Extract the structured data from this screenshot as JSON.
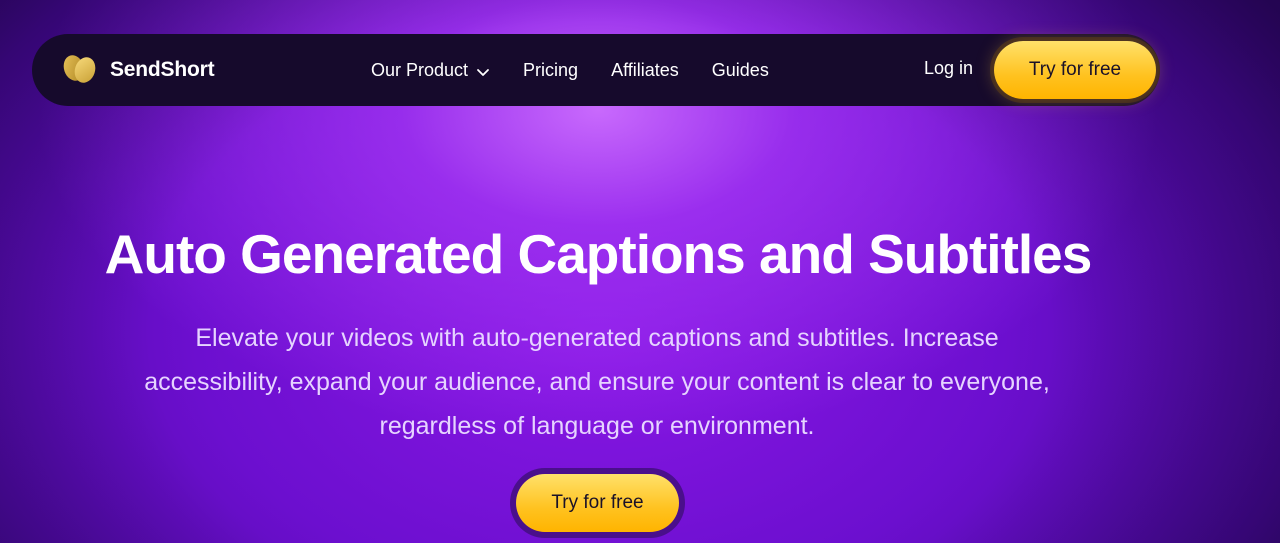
{
  "brand": {
    "name": "SendShort",
    "logo_icon": "heart-logo-icon",
    "accent": "#f4c542"
  },
  "nav": {
    "items": [
      {
        "label": "Our Product",
        "has_dropdown": true
      },
      {
        "label": "Pricing"
      },
      {
        "label": "Affiliates"
      },
      {
        "label": "Guides"
      }
    ],
    "login_label": "Log in",
    "cta_label": "Try for free"
  },
  "hero": {
    "title": "Auto Generated Captions and Subtitles",
    "subtitle_lines": [
      "Elevate your videos with auto-generated captions and subtitles. Increase",
      "accessibility, expand your audience, and ensure your content is clear to everyone,",
      "regardless of language or environment."
    ],
    "cta_label": "Try for free"
  },
  "colors": {
    "background": "#6c0fcf",
    "nav_background": "#160a2c",
    "cta": "#ffc21f",
    "text": "#ffffff"
  }
}
